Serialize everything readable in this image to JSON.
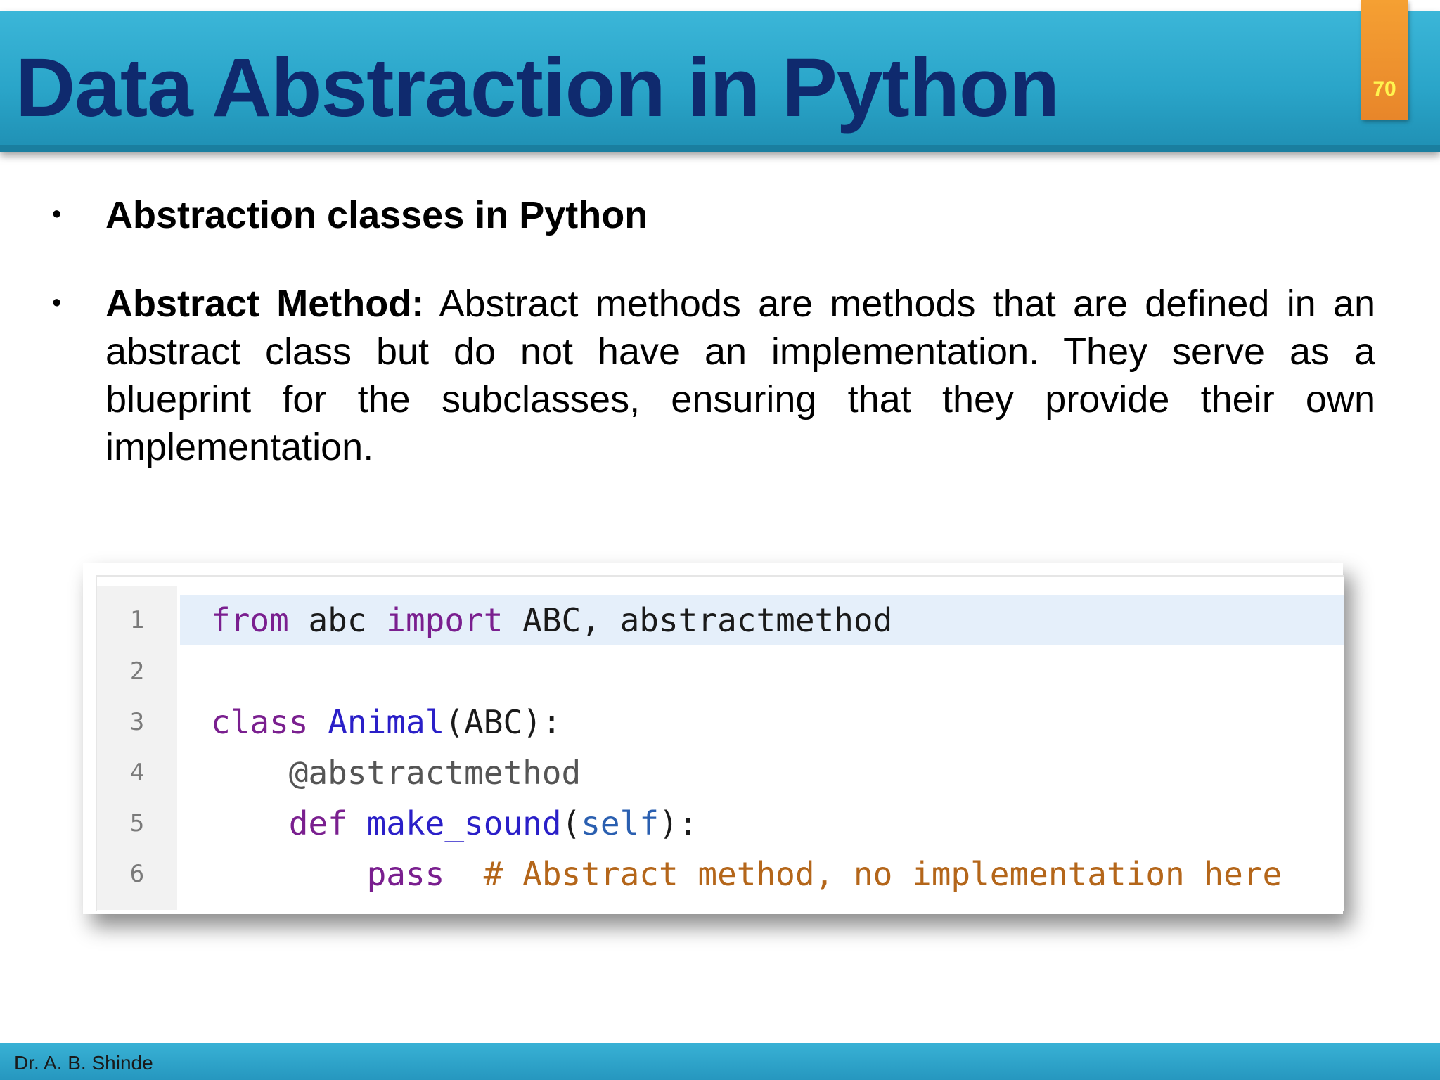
{
  "slide": {
    "title": "Data Abstraction in Python",
    "page_number": "70",
    "author": "Dr. A. B. Shinde"
  },
  "bullets": [
    {
      "text": "Abstraction classes in Python"
    },
    {
      "term": "Abstract Method:",
      "text": " Abstract methods are methods that are defined in an abstract class but do not have an implementation. They serve as a blueprint for the subclasses, ensuring that they provide their own implementation."
    }
  ],
  "code_block": {
    "line_numbers": [
      "1",
      "2",
      "3",
      "4",
      "5",
      "6"
    ],
    "highlighted_line": "1",
    "lines": [
      {
        "kw_from": "from",
        "module": " abc ",
        "kw_import": "import",
        "names": " ABC, abstractmethod"
      },
      {
        "text": ""
      },
      {
        "kw_class": "class",
        "space": " ",
        "class_name": "Animal",
        "rest": "(ABC):"
      },
      {
        "indent": "    ",
        "decorator": "@abstractmethod"
      },
      {
        "indent": "    ",
        "kw_def": "def",
        "space": " ",
        "func_name": "make_sound",
        "paren_open": "(",
        "param": "self",
        "rest": "):"
      },
      {
        "indent": "        ",
        "kw_pass": "pass",
        "gap": "  ",
        "comment": "# Abstract method, no implementation here"
      }
    ]
  },
  "colors": {
    "header": "#2aa5c9",
    "title": "#0f2a6e",
    "page_tab": "#e8862a",
    "page_number": "#fff44f",
    "footer": "#2697bf",
    "code_keyword": "#7a1f8f",
    "code_function": "#2a1fc8",
    "code_comment": "#b4661a",
    "code_highlight": "#e5effa"
  }
}
